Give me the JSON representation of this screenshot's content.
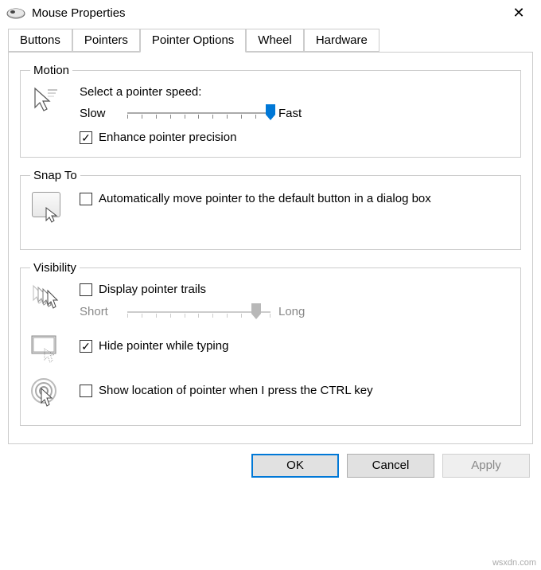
{
  "window": {
    "title": "Mouse Properties"
  },
  "tabs": {
    "buttons": "Buttons",
    "pointers": "Pointers",
    "pointer_options": "Pointer Options",
    "wheel": "Wheel",
    "hardware": "Hardware"
  },
  "motion": {
    "legend": "Motion",
    "prompt": "Select a pointer speed:",
    "slow": "Slow",
    "fast": "Fast",
    "speed_value": 10,
    "speed_ticks": 11,
    "enhance_checked": true,
    "enhance_label": "Enhance pointer precision"
  },
  "snap": {
    "legend": "Snap To",
    "auto_checked": false,
    "auto_label": "Automatically move pointer to the default button in a dialog box"
  },
  "visibility": {
    "legend": "Visibility",
    "trails_checked": false,
    "trails_label": "Display pointer trails",
    "short": "Short",
    "long": "Long",
    "trails_value": 9,
    "trails_ticks": 11,
    "hide_checked": true,
    "hide_label": "Hide pointer while typing",
    "ctrl_checked": false,
    "ctrl_label": "Show location of pointer when I press the CTRL key"
  },
  "buttons": {
    "ok": "OK",
    "cancel": "Cancel",
    "apply": "Apply"
  },
  "watermark": "wsxdn.com"
}
